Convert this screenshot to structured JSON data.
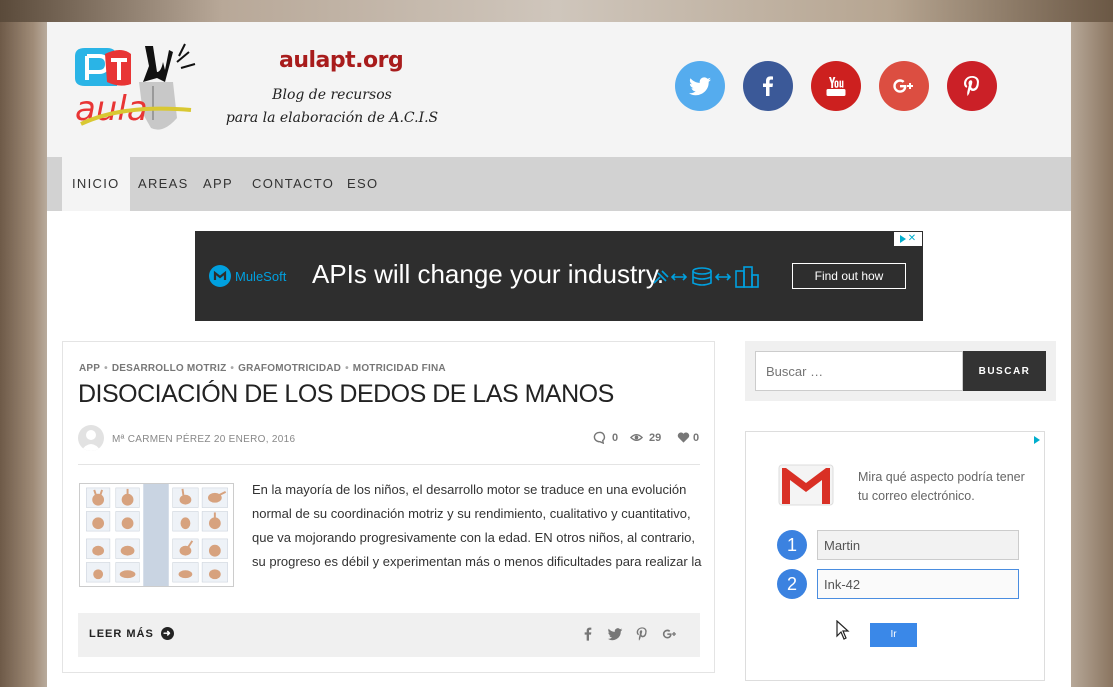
{
  "site": {
    "title": "aulapt.org",
    "description_line1": "Blog de recursos",
    "description_line2": "para la elaboración de A.C.I.S",
    "logo_text": "PT aula"
  },
  "social": [
    {
      "name": "twitter",
      "color": "#55acee",
      "icon": "twitter-icon"
    },
    {
      "name": "facebook",
      "color": "#3b5998",
      "icon": "facebook-icon"
    },
    {
      "name": "youtube",
      "color": "#cd201f",
      "icon": "youtube-icon"
    },
    {
      "name": "google-plus",
      "color": "#dc4e41",
      "icon": "google-plus-icon"
    },
    {
      "name": "pinterest",
      "color": "#cb2027",
      "icon": "pinterest-icon"
    }
  ],
  "nav": {
    "items": [
      "INICIO",
      "AREAS",
      "APP",
      "CONTACTO",
      "ESO"
    ],
    "active": "INICIO"
  },
  "top_ad": {
    "brand": "MuleSoft",
    "headline": "APIs will change your industry.",
    "cta": "Find out how"
  },
  "post": {
    "categories": [
      "APP",
      "DESARROLLO MOTRIZ",
      "GRAFOMOTRICIDAD",
      "MOTRICIDAD FINA"
    ],
    "category_separator": "•",
    "title": "DISOCIACIÓN DE LOS DEDOS DE LAS MANOS",
    "author": "Mª CARMEN PÉREZ",
    "date": "20 ENERO, 2016",
    "comments": "0",
    "views": "29",
    "likes": "0",
    "excerpt": "En la mayoría de los niños, el desarrollo motor se traduce en una evolución normal de su coordinación motriz y su rendimiento, cualitativo y cuantitativo, que va mojorando progresivamente con la edad. EN otros niños, al contrario, su progreso es débil y experimentan más o menos dificultades para realizar la",
    "read_more": "LEER MÁS"
  },
  "search": {
    "placeholder": "Buscar …",
    "button": "BUSCAR"
  },
  "side_ad": {
    "text": "Mira qué aspecto podría tener tu correo electrónico.",
    "step1": "1",
    "step2": "2",
    "field1_value": "Martin",
    "field2_value": "Ink-42",
    "button": "Ir"
  },
  "colors": {
    "title_red": "#a81c1c",
    "nav_bg": "#d2d2d2",
    "ad_bg": "#2e2e2e",
    "mulesoft_blue": "#00a0df",
    "step_blue": "#3b82e0"
  }
}
